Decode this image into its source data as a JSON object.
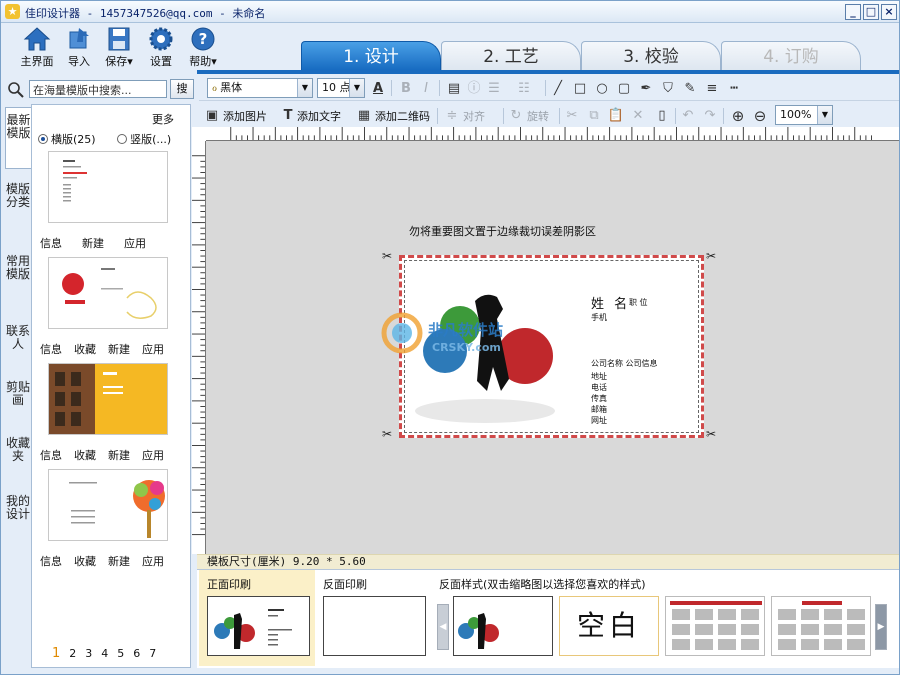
{
  "window": {
    "title": "佳印设计器 - 1457347526@qq.com - 未命名",
    "controls": [
      "_",
      "□",
      "×"
    ]
  },
  "main_toolbar": [
    {
      "id": "home",
      "label": "主界面",
      "icon": "house-icon"
    },
    {
      "id": "import",
      "label": "导入",
      "icon": "import-icon"
    },
    {
      "id": "save",
      "label": "保存▾",
      "icon": "floppy-icon"
    },
    {
      "id": "settings",
      "label": "设置",
      "icon": "gear-icon"
    },
    {
      "id": "help",
      "label": "帮助▾",
      "icon": "help-icon"
    }
  ],
  "steps": [
    {
      "label": "1. 设计",
      "state": "active"
    },
    {
      "label": "2. 工艺",
      "state": "normal"
    },
    {
      "label": "3. 校验",
      "state": "normal"
    },
    {
      "label": "4. 订购",
      "state": "disabled"
    }
  ],
  "search": {
    "placeholder": "在海量模版中搜索...",
    "button": "搜"
  },
  "side_tabs": [
    "最新模版",
    "模版分类",
    "常用模版",
    "联系人",
    "剪贴画",
    "收藏夹",
    "我的设计"
  ],
  "templates_panel": {
    "more": "更多",
    "orientation": [
      {
        "label": "横版(25)",
        "selected": true
      },
      {
        "label": "竖版(...)",
        "selected": false
      }
    ],
    "items": [
      {
        "links": [
          "信息",
          "新建",
          "应用"
        ]
      },
      {
        "links": [
          "信息",
          "收藏",
          "新建",
          "应用"
        ]
      },
      {
        "links": [
          "信息",
          "收藏",
          "新建",
          "应用"
        ]
      },
      {
        "links": [
          "信息",
          "收藏",
          "新建",
          "应用"
        ]
      }
    ],
    "pages": [
      "1",
      "2",
      "3",
      "4",
      "5",
      "6",
      "7"
    ]
  },
  "format_bar": {
    "font": "黑体",
    "size": "10 点",
    "zoom": "100%"
  },
  "insert_bar": {
    "add_image": "添加图片",
    "add_text": "添加文字",
    "add_qr": "添加二维码",
    "align": "对齐",
    "rotate": "旋转"
  },
  "canvas": {
    "warning": "勿将重要图文置于边缘裁切误差阴影区",
    "card": {
      "name": "姓 名",
      "title": "职 位",
      "phone": "手机",
      "company": "公司名称  公司信息",
      "fields": [
        "地址",
        "电话",
        "传真",
        "邮箱",
        "网址"
      ]
    },
    "watermark": {
      "cn": "非凡软件站",
      "en": "CRSKY.com"
    }
  },
  "size_text": "模板尺寸(厘米) 9.20 * 5.60",
  "bottom": {
    "front": "正面印刷",
    "back": "反面印刷",
    "back_style": "反面样式(双击缩略图以选择您喜欢的样式)",
    "blank": "空白"
  },
  "colors": {
    "accent": "#1a6bbf",
    "tab_active": "#2e86d8",
    "cut_line": "#d04a4a",
    "size_bar": "#f1ecd2"
  }
}
